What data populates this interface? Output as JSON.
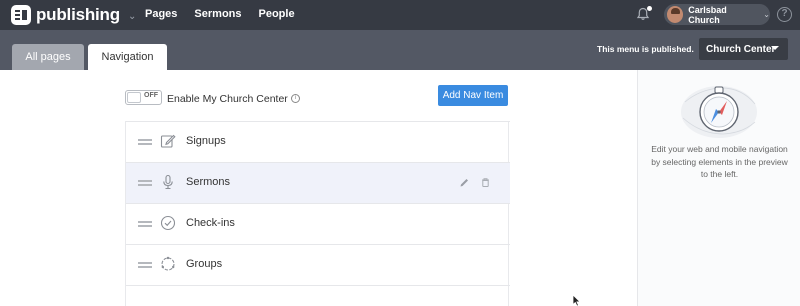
{
  "app": {
    "name": "publishing"
  },
  "topnav": {
    "items": [
      "Pages",
      "Sermons",
      "People"
    ]
  },
  "account": {
    "name": "Carlsbad Church"
  },
  "help": {
    "glyph": "?"
  },
  "tabs": {
    "all": "All pages",
    "navigation": "Navigation"
  },
  "publish": {
    "status": "This menu is published.",
    "selector": "Church Center"
  },
  "toggle": {
    "state": "OFF",
    "label": "Enable My Church Center",
    "info": "i"
  },
  "actions": {
    "add_nav_item": "Add Nav Item"
  },
  "nav_items": [
    {
      "label": "Signups",
      "icon": "pencil-square-icon"
    },
    {
      "label": "Sermons",
      "icon": "microphone-icon"
    },
    {
      "label": "Check-ins",
      "icon": "check-circle-icon"
    },
    {
      "label": "Groups",
      "icon": "groups-circle-icon"
    }
  ],
  "sidebar": {
    "help": "Edit your web and mobile navigation by selecting elements in the preview to the left."
  },
  "colors": {
    "topbar": "#363a43",
    "subbar": "#535864",
    "accent": "#3a8be0",
    "active_row": "#f0f2fa"
  }
}
